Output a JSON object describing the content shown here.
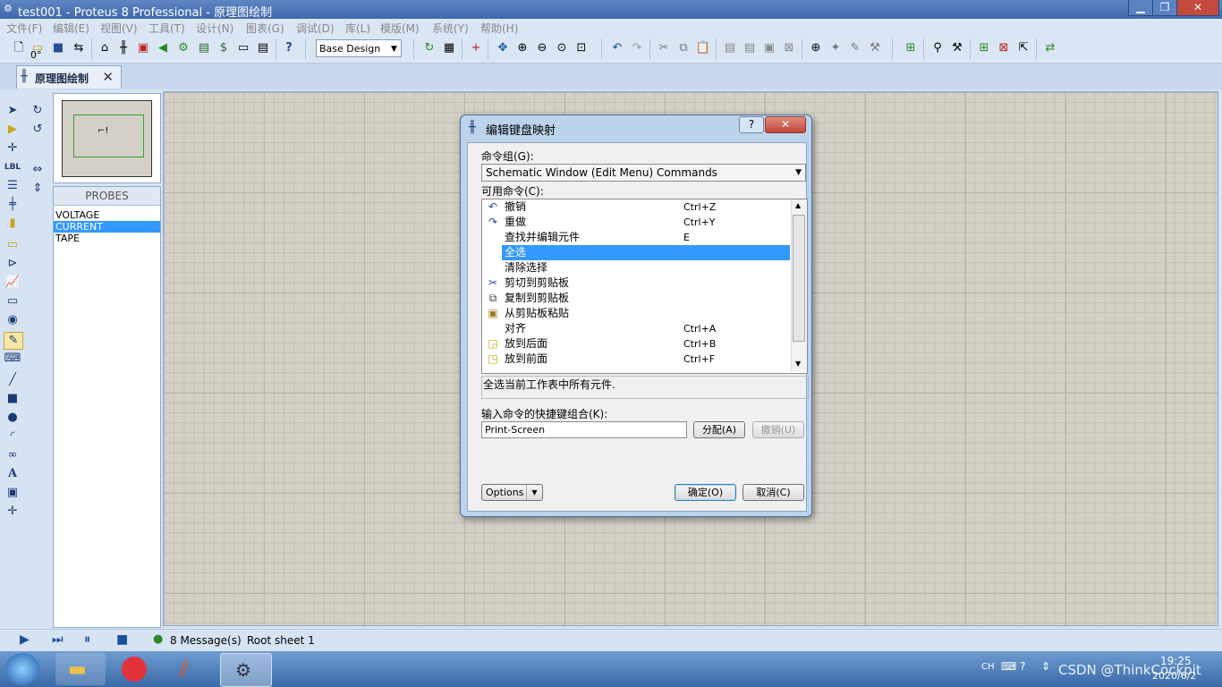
{
  "window": {
    "title": "test001 - Proteus 8 Professional - 原理图绘制",
    "minimize": "▁",
    "maximize": "❐",
    "close": "✕"
  },
  "menu": [
    "文件(F)",
    "编辑(E)",
    "视图(V)",
    "工具(T)",
    "设计(N)",
    "图表(G)",
    "调试(D)",
    "库(L)",
    "模版(M)",
    "系统(Y)",
    "帮助(H)"
  ],
  "toolbar": {
    "design_select": "Base Design"
  },
  "tab": {
    "label": "原理图绘制"
  },
  "left_panel": {
    "rotation": "0°"
  },
  "probes": {
    "header": "PROBES",
    "items": [
      "VOLTAGE",
      "CURRENT",
      "TAPE"
    ],
    "selected": "CURRENT"
  },
  "statusbar": {
    "messages": "8 Message(s)",
    "sheet": "Root sheet 1"
  },
  "dialog": {
    "title": "编辑键盘映射",
    "help": "?",
    "close": "✕",
    "group_label": "命令组(G):",
    "group_value": "Schematic Window (Edit Menu) Commands",
    "commands_label": "可用命令(C):",
    "commands": [
      {
        "name": "撤销",
        "shortcut": "Ctrl+Z",
        "icon": "undo-icon"
      },
      {
        "name": "重做",
        "shortcut": "Ctrl+Y",
        "icon": "redo-icon"
      },
      {
        "name": "查找并编辑元件",
        "shortcut": "E",
        "icon": ""
      },
      {
        "name": "全选",
        "shortcut": "",
        "icon": ""
      },
      {
        "name": "清除选择",
        "shortcut": "",
        "icon": ""
      },
      {
        "name": "剪切到剪贴板",
        "shortcut": "",
        "icon": "scissors-icon"
      },
      {
        "name": "复制到剪贴板",
        "shortcut": "",
        "icon": "copy-icon"
      },
      {
        "name": "从剪贴板粘贴",
        "shortcut": "",
        "icon": "paste-icon"
      },
      {
        "name": "对齐",
        "shortcut": "Ctrl+A",
        "icon": ""
      },
      {
        "name": "放到后面",
        "shortcut": "Ctrl+B",
        "icon": "send-back-icon"
      },
      {
        "name": "放到前面",
        "shortcut": "Ctrl+F",
        "icon": "bring-front-icon"
      }
    ],
    "selected_command": "全选",
    "description": "全选当前工作表中所有元件.",
    "key_label": "输入命令的快捷键组合(K):",
    "key_value": "Print-Screen",
    "assign": "分配(A)",
    "unassign": "撤销(U)",
    "options": "Options",
    "ok": "确定(O)",
    "cancel": "取消(C)"
  },
  "taskbar": {
    "lang": "CH",
    "time": "19:25",
    "date": "2020/6/2",
    "watermark": "CSDN @ThinkCockpit"
  }
}
